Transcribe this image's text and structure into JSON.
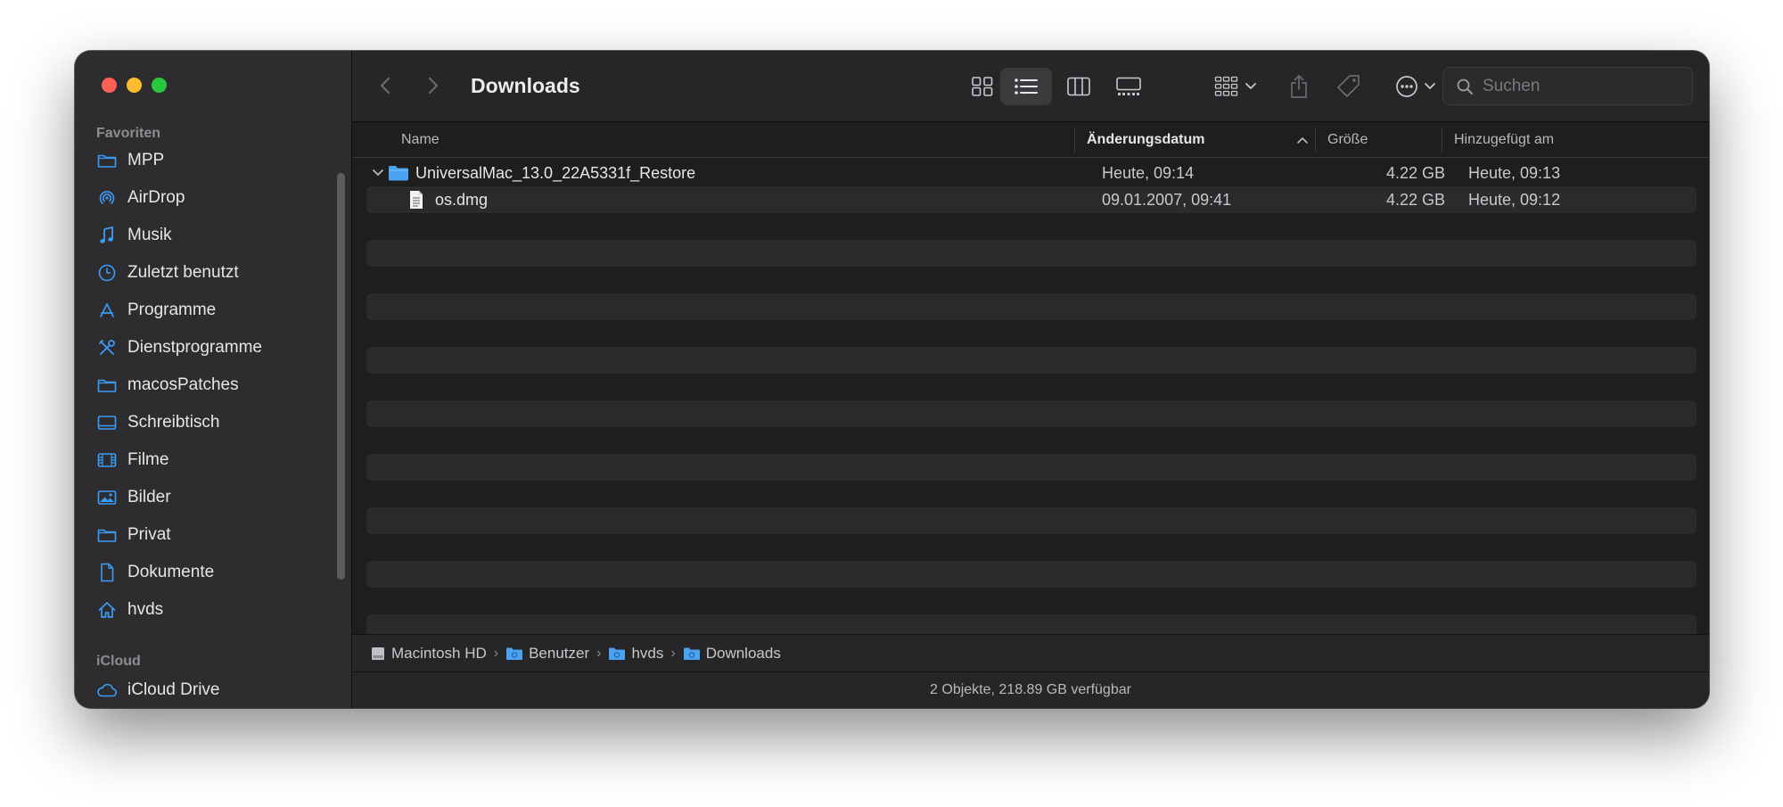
{
  "window": {
    "title": "Downloads"
  },
  "sidebar": {
    "favorites_label": "Favoriten",
    "items": [
      {
        "label": "MPP",
        "icon": "folder-icon"
      },
      {
        "label": "AirDrop",
        "icon": "airdrop-icon"
      },
      {
        "label": "Musik",
        "icon": "music-note-icon"
      },
      {
        "label": "Zuletzt benutzt",
        "icon": "clock-icon"
      },
      {
        "label": "Programme",
        "icon": "apps-icon"
      },
      {
        "label": "Dienstprogramme",
        "icon": "tools-icon"
      },
      {
        "label": "macosPatches",
        "icon": "folder-icon"
      },
      {
        "label": "Schreibtisch",
        "icon": "desktop-icon"
      },
      {
        "label": "Filme",
        "icon": "film-icon"
      },
      {
        "label": "Bilder",
        "icon": "photo-icon"
      },
      {
        "label": "Privat",
        "icon": "folder-icon"
      },
      {
        "label": "Dokumente",
        "icon": "document-icon"
      },
      {
        "label": "hvds",
        "icon": "home-icon"
      }
    ],
    "icloud_label": "iCloud",
    "icloud_items": [
      {
        "label": "iCloud Drive",
        "icon": "cloud-icon"
      }
    ]
  },
  "search": {
    "placeholder": "Suchen"
  },
  "columns": {
    "name": "Name",
    "date": "Änderungsdatum",
    "size": "Größe",
    "added": "Hinzugefügt am"
  },
  "files": [
    {
      "name": "UniversalMac_13.0_22A5331f_Restore",
      "date": "Heute, 09:14",
      "size": "4.22 GB",
      "added": "Heute, 09:13",
      "kind": "folder",
      "expanded": true
    },
    {
      "name": "os.dmg",
      "date": "09.01.2007, 09:41",
      "size": "4.22 GB",
      "added": "Heute, 09:12",
      "kind": "document"
    }
  ],
  "pathbar": {
    "crumbs": [
      "Macintosh HD",
      "Benutzer",
      "hvds",
      "Downloads"
    ],
    "separator": "›"
  },
  "status": "2 Objekte, 218.89 GB verfügbar",
  "colors": {
    "accent": "#3b9bf6",
    "close": "#ff5f57",
    "minimize": "#febc2e",
    "maximize": "#28c840"
  }
}
